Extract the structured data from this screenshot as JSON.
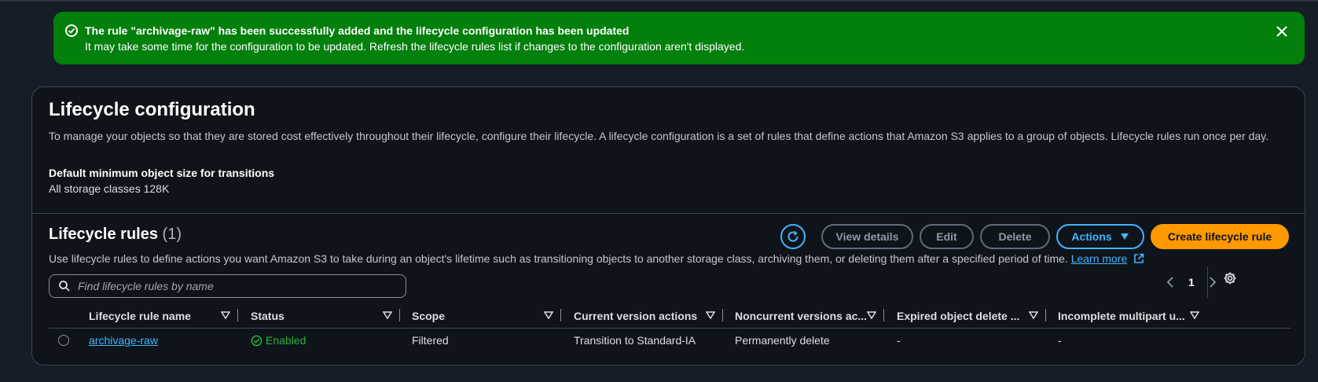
{
  "flash": {
    "title": "The rule \"archivage-raw\" has been successfully added and the lifecycle configuration has been updated",
    "message": "It may take some time for the configuration to be updated. Refresh the lifecycle rules list if changes to the configuration aren't displayed.",
    "icon": "check-circle-icon",
    "color": "#037f0c"
  },
  "lifecycle": {
    "title": "Lifecycle configuration",
    "description": "To manage your objects so that they are stored cost effectively throughout their lifecycle, configure their lifecycle. A lifecycle configuration is a set of rules that define actions that Amazon S3 applies to a group of objects. Lifecycle rules run once per day.",
    "min_size_label": "Default minimum object size for transitions",
    "min_size_value": "All storage classes 128K"
  },
  "rules": {
    "title": "Lifecycle rules",
    "count": "(1)",
    "description": "Use lifecycle rules to define actions you want Amazon S3 to take during an object's lifetime such as transitioning objects to another storage class, archiving them, or deleting them after a specified period of time.",
    "learn_more": "Learn more",
    "buttons": {
      "view_details": "View details",
      "edit": "Edit",
      "delete": "Delete",
      "actions": "Actions",
      "create": "Create lifecycle rule"
    },
    "search_placeholder": "Find lifecycle rules by name",
    "page": "1",
    "columns": [
      "Lifecycle rule name",
      "Status",
      "Scope",
      "Current version actions",
      "Noncurrent versions ac...",
      "Expired object delete ...",
      "Incomplete multipart u..."
    ],
    "rows": [
      {
        "name": "archivage-raw",
        "status": "Enabled",
        "scope": "Filtered",
        "current": "Transition to Standard-IA",
        "noncurrent": "Permanently delete",
        "expired": "-",
        "incomplete": "-"
      }
    ]
  },
  "colors": {
    "background": "#161d26",
    "accent": "#42b4ff",
    "primary_button": "#ff9900",
    "success": "#2bb534"
  }
}
